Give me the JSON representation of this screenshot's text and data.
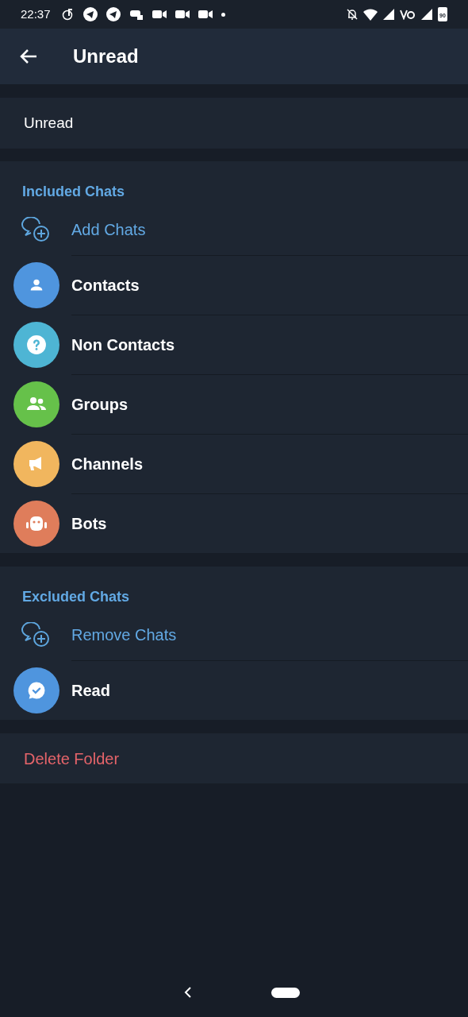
{
  "status_bar": {
    "time": "22:37",
    "battery": "90"
  },
  "header": {
    "title": "Unread"
  },
  "folder_name": {
    "value": "Unread"
  },
  "included": {
    "title": "Included Chats",
    "add_label": "Add Chats",
    "items": [
      {
        "label": "Contacts",
        "kind": "contacts",
        "color": "#4f95de"
      },
      {
        "label": "Non Contacts",
        "kind": "non_contacts",
        "color": "#4eb5d4"
      },
      {
        "label": "Groups",
        "kind": "groups",
        "color": "#66c14a"
      },
      {
        "label": "Channels",
        "kind": "channels",
        "color": "#f1b65e"
      },
      {
        "label": "Bots",
        "kind": "bots",
        "color": "#df7d5b"
      }
    ]
  },
  "excluded": {
    "title": "Excluded Chats",
    "add_label": "Remove Chats",
    "items": [
      {
        "label": "Read",
        "kind": "read",
        "color": "#4f95de"
      }
    ]
  },
  "delete_label": "Delete Folder"
}
